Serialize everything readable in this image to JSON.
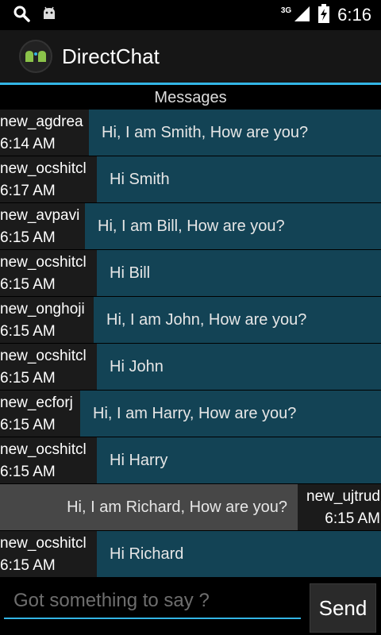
{
  "status_bar": {
    "network": "3G",
    "time": "6:16"
  },
  "app": {
    "title": "DirectChat"
  },
  "header": {
    "title": "Messages"
  },
  "messages": [
    {
      "sender": "new_agdrea",
      "time": "6:14 AM",
      "text": "Hi, I am Smith, How are you?"
    },
    {
      "sender": "new_ocshitcl",
      "time": "6:17 AM",
      "text": "Hi Smith"
    },
    {
      "sender": "new_avpavi",
      "time": "6:15 AM",
      "text": "Hi, I am Bill, How are you?"
    },
    {
      "sender": "new_ocshitcl",
      "time": "6:15 AM",
      "text": "Hi Bill"
    },
    {
      "sender": "new_onghoji",
      "time": "6:15 AM",
      "text": "Hi, I am John, How are you?"
    },
    {
      "sender": "new_ocshitcl",
      "time": "6:15 AM",
      "text": "Hi John"
    },
    {
      "sender": "new_ecforj",
      "time": "6:15 AM",
      "text": "Hi, I am Harry, How are you?"
    },
    {
      "sender": "new_ocshitcl",
      "time": "6:15 AM",
      "text": "Hi Harry"
    },
    {
      "sender": "new_ujtrud",
      "time": "6:15 AM",
      "text": "Hi, I am Richard, How are you?"
    },
    {
      "sender": "new_ocshitcl",
      "time": "6:15 AM",
      "text": "Hi Richard"
    }
  ],
  "composer": {
    "placeholder": "Got something to say ?",
    "send_label": "Send"
  },
  "colors": {
    "accent": "#33b5e5",
    "bubble": "#134355",
    "highlight_row": "#474747"
  },
  "icons": {
    "status_left": [
      "search-icon",
      "android-icon"
    ],
    "status_right": [
      "signal-icon",
      "battery-icon"
    ]
  }
}
